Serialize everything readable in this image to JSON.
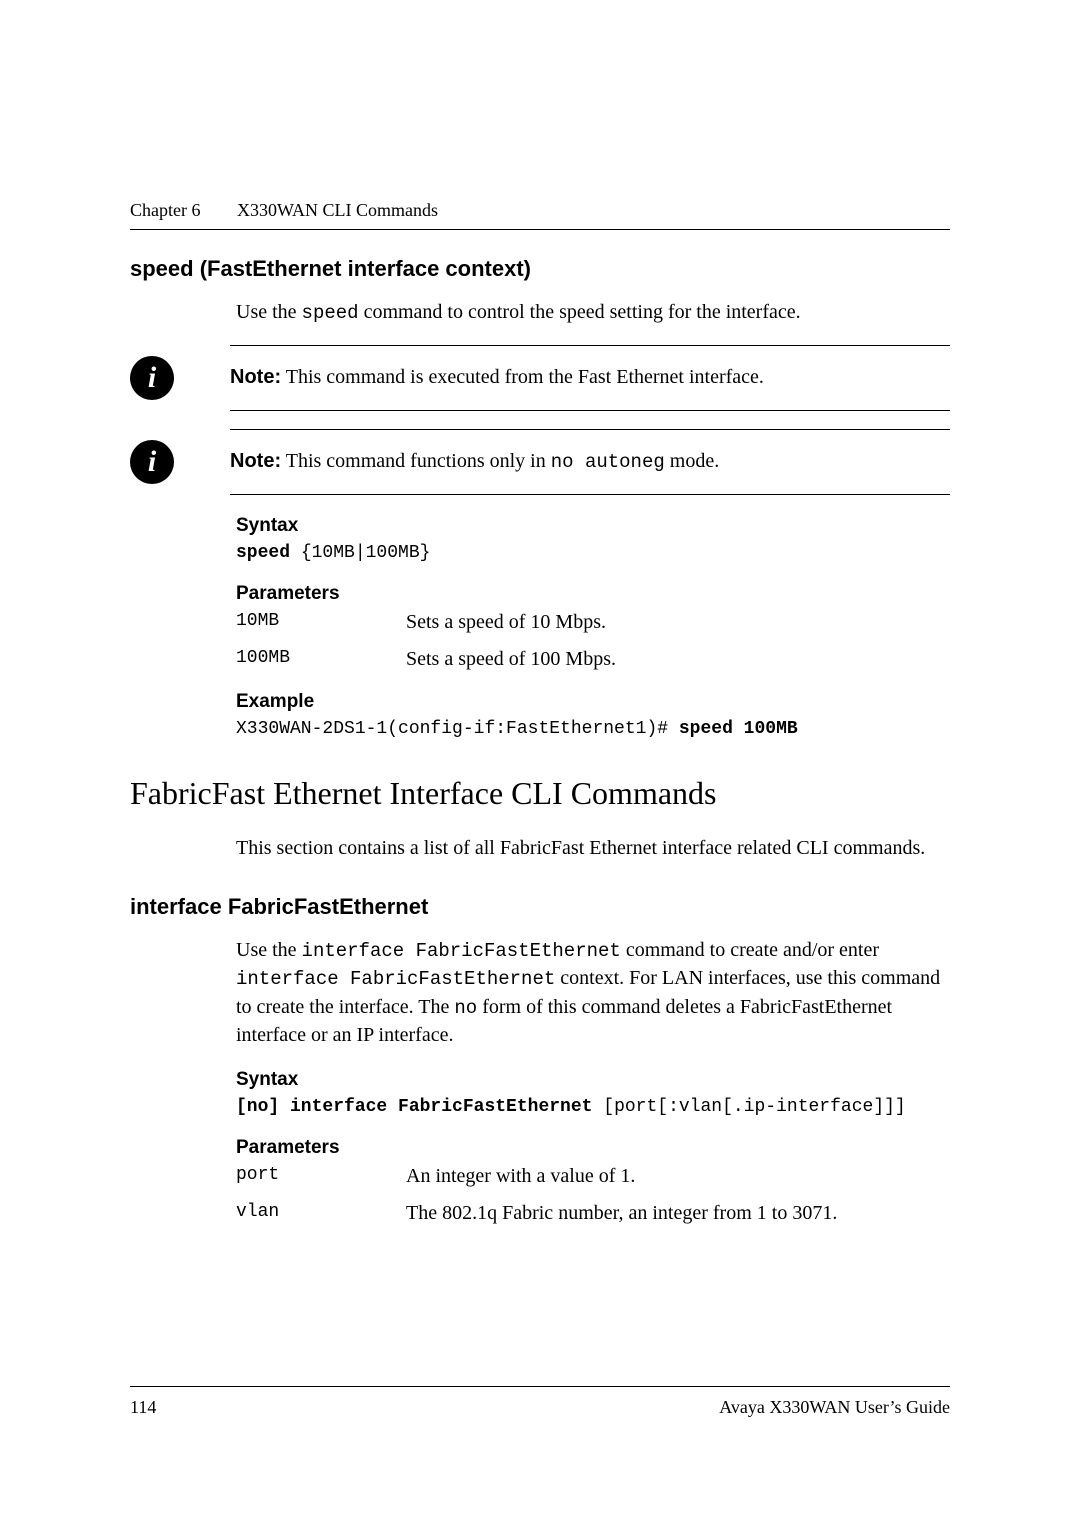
{
  "header": {
    "chapter": "Chapter 6",
    "title": "X330WAN CLI Commands"
  },
  "sec1": {
    "title": "speed (FastEthernet interface context)",
    "intro_a": "Use the ",
    "intro_code": "speed",
    "intro_b": " command to control the speed setting for the interface."
  },
  "note1": {
    "label": "Note:",
    "text": "This command is executed from the Fast Ethernet interface."
  },
  "note2": {
    "label": "Note:",
    "text_a": "This command functions only in ",
    "code": "no autoneg",
    "text_b": " mode."
  },
  "syntax1": {
    "heading": "Syntax",
    "kw": "speed",
    "args": " {10MB|100MB}"
  },
  "params1": {
    "heading": "Parameters",
    "rows": [
      {
        "name": "10MB",
        "desc": "Sets a speed of 10 Mbps."
      },
      {
        "name": "100MB",
        "desc": "Sets a speed of 100 Mbps."
      }
    ]
  },
  "example1": {
    "heading": "Example",
    "prefix": "X330WAN-2DS1-1(config-if:FastEthernet1)# ",
    "cmd": "speed 100MB"
  },
  "sec2": {
    "title": "FabricFast Ethernet Interface CLI Commands",
    "intro": "This section contains a list of all FabricFast Ethernet interface related CLI commands."
  },
  "sec3": {
    "title": "interface FabricFastEthernet",
    "p_a": "Use the ",
    "p_code1": "interface FabricFastEthernet",
    "p_b": " command to create and/or enter ",
    "p_code2": "interface FabricFastEthernet",
    "p_c": " context. For LAN interfaces, use this command to create the interface. The ",
    "p_code3": "no",
    "p_d": " form of this command deletes a FabricFastEthernet interface or an IP interface."
  },
  "syntax2": {
    "heading": "Syntax",
    "kw": "[no] interface FabricFastEthernet",
    "args": " [port[:vlan[.ip-interface]]]"
  },
  "params2": {
    "heading": "Parameters",
    "rows": [
      {
        "name": "port",
        "desc": "An integer with a value of 1."
      },
      {
        "name": "vlan",
        "desc": "The 802.1q Fabric number, an integer from 1 to 3071."
      }
    ]
  },
  "footer": {
    "page": "114",
    "guide": "Avaya X330WAN User’s Guide"
  }
}
